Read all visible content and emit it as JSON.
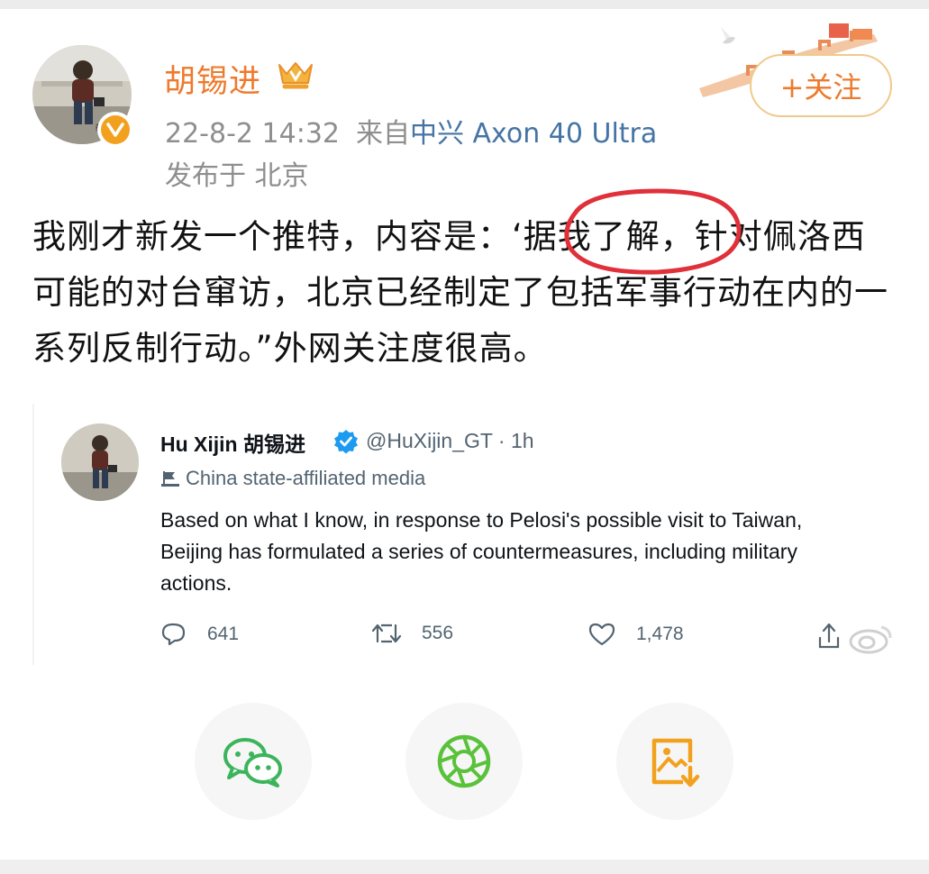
{
  "header": {
    "username": "胡锡进",
    "timestamp": "22-8-2 14:32",
    "source_prefix": "来自",
    "source": "中兴 Axon 40 Ultra",
    "location": "发布于 北京",
    "follow_label": "+关注"
  },
  "post": {
    "text": "我刚才新发一个推特，内容是：‘据我了解，针对佩洛西可能的对台窜访，北京已经制定了包括军事行动在内的一系列反制行动。”外网关注度很高。"
  },
  "tweet": {
    "name": "Hu Xijin 胡锡进",
    "handle_time": "@HuXijin_GT · 1h",
    "label": "China state-affiliated media",
    "text": "Based on what I know, in response to Pelosi's possible visit to Taiwan,\nBeijing has formulated a series of countermeasures, including military\nactions.",
    "replies": "641",
    "retweets": "556",
    "likes": "1,478"
  },
  "share": {
    "icons": [
      "wechat-icon",
      "moments-icon",
      "save-image-icon"
    ]
  },
  "colors": {
    "username": "#ee7a2c",
    "link": "#4574a4",
    "meta": "#8e8e8e",
    "wechat": "#3cb45c",
    "moments": "#59c23a",
    "save": "#f2a11f",
    "annotation_circle": "#e0303a"
  }
}
